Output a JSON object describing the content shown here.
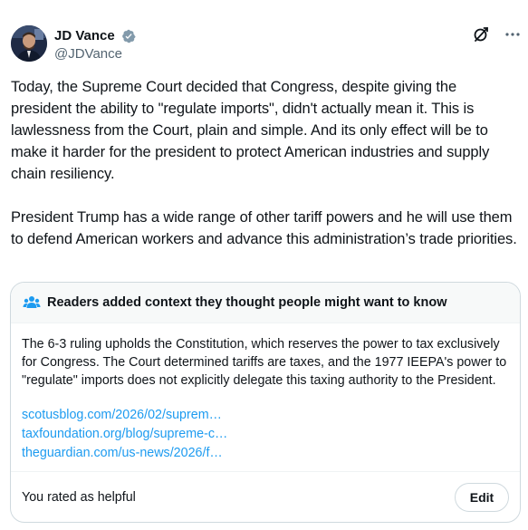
{
  "author": {
    "display_name": "JD Vance",
    "handle": "@JDVance",
    "verified_icon": "verified-badge-icon",
    "avatar_icon": "avatar"
  },
  "actions": {
    "grok_icon": "grok-icon",
    "more_icon": "more-options-icon"
  },
  "tweet": {
    "paragraph_1": "Today, the Supreme Court decided that Congress, despite giving the president the ability to \"regulate imports\", didn't actually mean it. This is lawlessness from the Court, plain and simple. And its only effect will be to make it harder for the president to protect American industries and supply chain resiliency.",
    "paragraph_2": "President Trump has a wide range of other tariff powers and he will use them to defend American workers and advance this administration’s trade priorities."
  },
  "community_note": {
    "title": "Readers added context they thought people might want to know",
    "body": "The 6-3 ruling upholds the Constitution, which reserves the power to tax exclusively for Congress. The Court determined tariffs are taxes, and the 1977 IEEPA's power to \"regulate\" imports does not explicitly delegate this taxing authority to the President.",
    "links": [
      "scotusblog.com/2026/02/suprem…",
      "taxfoundation.org/blog/supreme-c…",
      "theguardian.com/us-news/2026/f…"
    ],
    "rated_text": "You rated as helpful",
    "edit_label": "Edit"
  },
  "colors": {
    "text": "#0f1419",
    "secondary": "#536471",
    "link": "#1d9bf0",
    "border": "#cfd9de",
    "note_header_bg": "#f7f9f9",
    "verified_badge": "#829aab"
  }
}
